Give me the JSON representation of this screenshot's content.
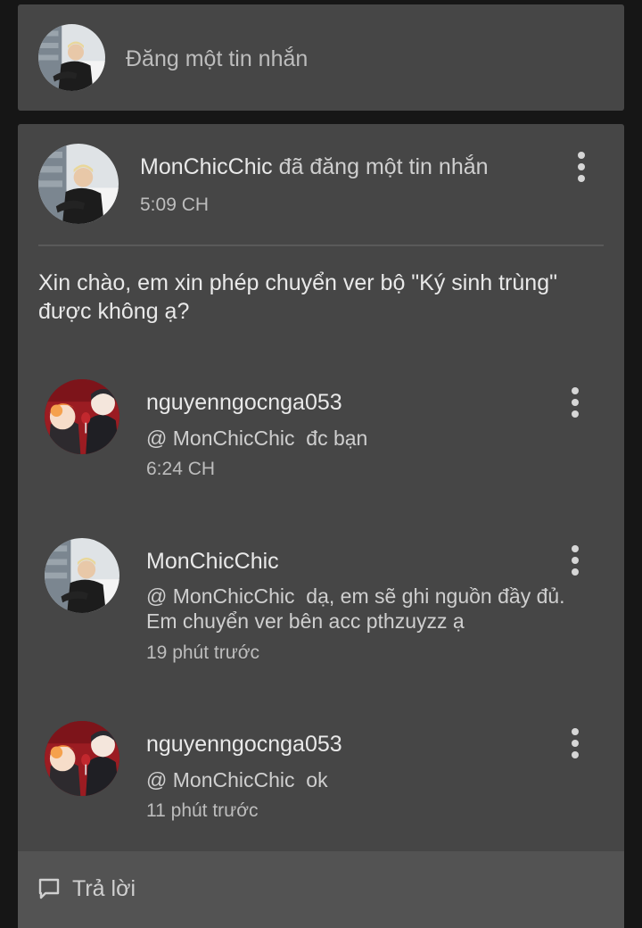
{
  "compose": {
    "placeholder": "Đăng một tin nhắn"
  },
  "post": {
    "author": "MonChicChic",
    "action": "đã đăng một tin nhắn",
    "time": "5:09 CH",
    "body": "Xin chào, em xin phép chuyển ver bộ \"Ký sinh trùng\" được không ạ?",
    "menu_icon": "more-vertical-icon"
  },
  "replies": [
    {
      "author": "nguyenngocnga053",
      "mention": "@ MonChicChic",
      "text_lines": [
        "đc bạn"
      ],
      "time": "6:24 CH",
      "avatar": "cartoon-avatar"
    },
    {
      "author": "MonChicChic",
      "mention": "@ MonChicChic",
      "text_lines": [
        "dạ, em sẽ ghi nguồn đầy đủ.",
        "Em chuyển ver bên acc pthzuyzz ạ"
      ],
      "time": "19 phút trước",
      "avatar": "photo-avatar"
    },
    {
      "author": "nguyenngocnga053",
      "mention": "@ MonChicChic",
      "text_lines": [
        "ok"
      ],
      "time": "11 phút trước",
      "avatar": "cartoon-avatar"
    }
  ],
  "reply_bar": {
    "label": "Trả lời",
    "icon": "comment-icon"
  }
}
